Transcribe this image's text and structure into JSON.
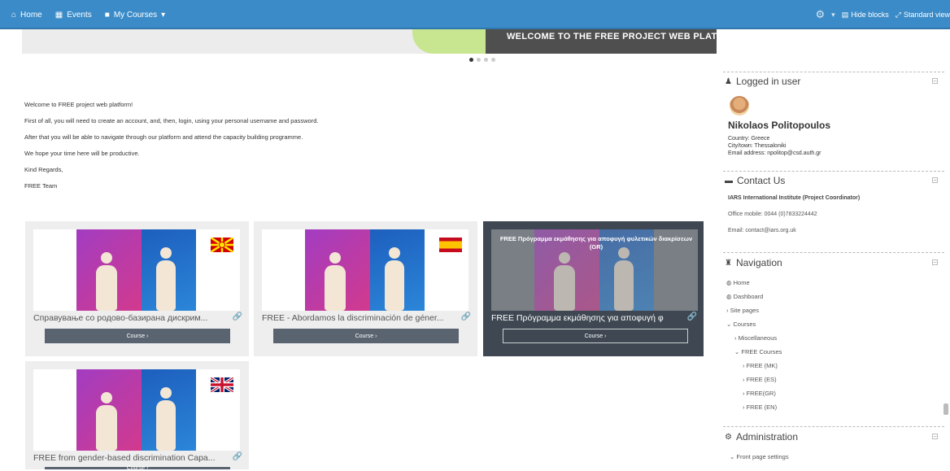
{
  "topbar": {
    "home": "Home",
    "events": "Events",
    "my_courses": "My Courses",
    "hide_blocks": "Hide blocks",
    "standard_view": "Standard view"
  },
  "banner": {
    "title": "WELCOME TO THE FREE PROJECT WEB PLATFORM"
  },
  "intro": {
    "lines": [
      "Welcome to FREE project web platform!",
      "First of all, you will need to create an account, and, then, login, using your personal username and password.",
      "After that you will be able to navigate through our platform and attend the capacity building programme.",
      "We hope your time here will be productive.",
      "Kind Regards,",
      "FREE Team"
    ]
  },
  "courses": [
    {
      "title": "Справување со родово-базирана дискрим...",
      "button": "Course ›"
    },
    {
      "title": "FREE - Abordamos la discriminación de géner...",
      "button": "Course ›"
    },
    {
      "title": "FREE Πρόγραμμα εκμάθησης για αποφυγή φ",
      "overlay": "FREE Πρόγραμμα εκμάθησης για αποφυγή φυλετικών διακρίσεων (GR)",
      "button": "Course ›"
    },
    {
      "title": "FREE from gender-based discrimination Capa...",
      "button": "Course ›"
    }
  ],
  "logged_in": {
    "block_title": "Logged in user",
    "name": "Nikolaos Politopoulos",
    "country": "Country: Greece",
    "city": "City/town: Thessaloniki",
    "email": "Email address: npolitop@csd.auth.gr"
  },
  "contact": {
    "block_title": "Contact Us",
    "org": "IARS International Institute (Project Coordinator)",
    "phone": "Office mobile: 0044 (0)7833224442",
    "email": "Email: contact@iars.org.uk"
  },
  "navigation": {
    "block_title": "Navigation",
    "items": [
      "Home",
      "Dashboard",
      "Site pages",
      "Courses",
      "Miscellaneous",
      "FREE Courses",
      "FREE (MK)",
      "FREE (ES)",
      "FREE(GR)",
      "FREE (EN)"
    ]
  },
  "administration": {
    "block_title": "Administration",
    "items": [
      "Front page settings"
    ]
  },
  "colors": {
    "topbar": "#3a8bc8",
    "button": "#5a6470",
    "dark_card": "#3f4852"
  }
}
